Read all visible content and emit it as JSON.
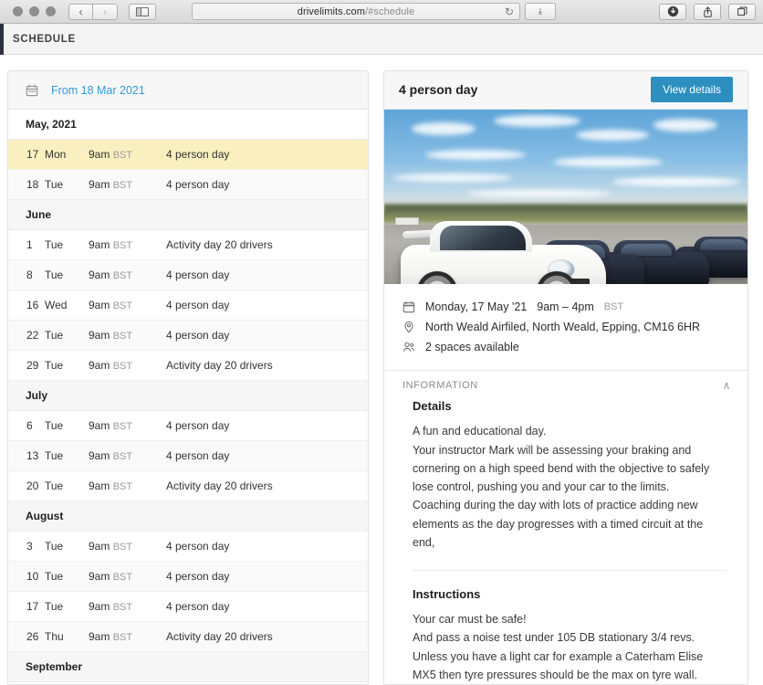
{
  "browser": {
    "url_domain": "drivelimits.com",
    "url_path": "/#schedule",
    "back_label": "‹",
    "forward_label": "›",
    "reload_label": "↻",
    "reader_label": "⤓"
  },
  "app": {
    "header_title": "SCHEDULE"
  },
  "schedule": {
    "picker_label": "From 18 Mar 2021",
    "groups": [
      {
        "month": "May, 2021",
        "rows": [
          {
            "day": "17",
            "dow": "Mon",
            "time": "9am",
            "tz": "BST",
            "name": "4 person day",
            "selected": true
          },
          {
            "day": "18",
            "dow": "Tue",
            "time": "9am",
            "tz": "BST",
            "name": "4 person day",
            "selected": false
          }
        ]
      },
      {
        "month": "June",
        "rows": [
          {
            "day": "1",
            "dow": "Tue",
            "time": "9am",
            "tz": "BST",
            "name": "Activity day 20 drivers",
            "selected": false
          },
          {
            "day": "8",
            "dow": "Tue",
            "time": "9am",
            "tz": "BST",
            "name": "4 person day",
            "selected": false
          },
          {
            "day": "16",
            "dow": "Wed",
            "time": "9am",
            "tz": "BST",
            "name": "4 person day",
            "selected": false
          },
          {
            "day": "22",
            "dow": "Tue",
            "time": "9am",
            "tz": "BST",
            "name": "4 person day",
            "selected": false
          },
          {
            "day": "29",
            "dow": "Tue",
            "time": "9am",
            "tz": "BST",
            "name": "Activity day 20 drivers",
            "selected": false
          }
        ]
      },
      {
        "month": "July",
        "rows": [
          {
            "day": "6",
            "dow": "Tue",
            "time": "9am",
            "tz": "BST",
            "name": "4 person day",
            "selected": false
          },
          {
            "day": "13",
            "dow": "Tue",
            "time": "9am",
            "tz": "BST",
            "name": "4 person day",
            "selected": false
          },
          {
            "day": "20",
            "dow": "Tue",
            "time": "9am",
            "tz": "BST",
            "name": "Activity day 20 drivers",
            "selected": false
          }
        ]
      },
      {
        "month": "August",
        "rows": [
          {
            "day": "3",
            "dow": "Tue",
            "time": "9am",
            "tz": "BST",
            "name": "4 person day",
            "selected": false
          },
          {
            "day": "10",
            "dow": "Tue",
            "time": "9am",
            "tz": "BST",
            "name": "4 person day",
            "selected": false
          },
          {
            "day": "17",
            "dow": "Tue",
            "time": "9am",
            "tz": "BST",
            "name": "4 person day",
            "selected": false
          },
          {
            "day": "26",
            "dow": "Thu",
            "time": "9am",
            "tz": "BST",
            "name": "Activity day 20 drivers",
            "selected": false
          }
        ]
      },
      {
        "month": "September",
        "rows": []
      }
    ]
  },
  "detail": {
    "title": "4 person day",
    "view_details_label": "View details",
    "photo_alt": "White Porsche 911 GT3 RS parked on airfield tarmac with dark Porsches behind",
    "meta": {
      "date_text": "Monday, 17 May '21",
      "time_text": "9am – 4pm",
      "time_tz": "BST",
      "location": "North Weald Airfiled, North Weald, Epping, CM16 6HR",
      "spaces": "2 spaces available"
    },
    "information": {
      "section_label": "INFORMATION",
      "collapse_icon": "∧",
      "details_title": "Details",
      "details_body": "A fun and educational day.\nYour instructor Mark will be assessing your braking and cornering on a high speed bend with the objective to safely lose control, pushing you and your car to the limits.\nCoaching during the day with lots of practice adding new elements as the day progresses with a timed circuit at the end,",
      "instructions_title": "Instructions",
      "instructions_body": "Your car must be safe!\nAnd pass a noise test under 105 DB stationary 3/4 revs.\nUnless you have a light car for example a Caterham Elise MX5 then tyre pressures should be the max on tyre wall."
    }
  },
  "colors": {
    "accent_blue": "#2c8fc0",
    "link_blue": "#2e9bd6",
    "selected_row": "#faf0bf",
    "rail_navy": "#2e3142"
  }
}
